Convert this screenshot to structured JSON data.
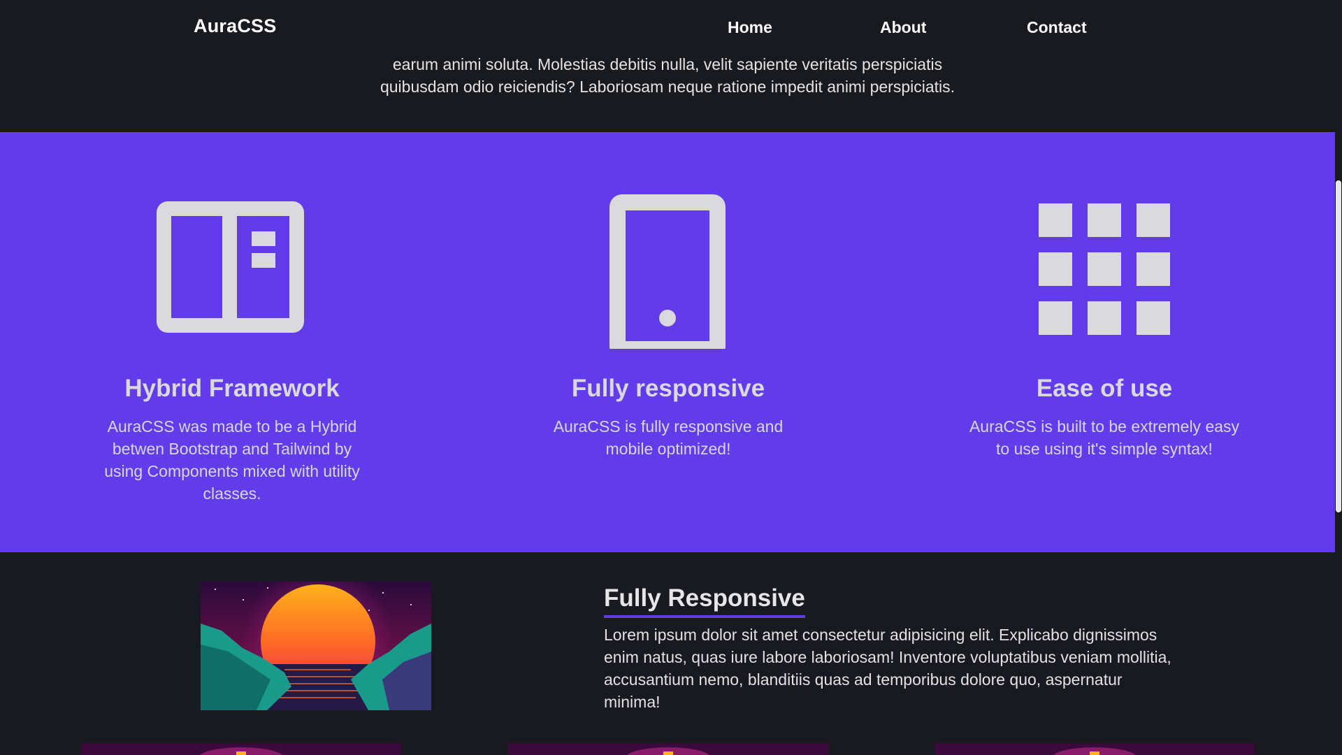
{
  "navbar": {
    "brand": "AuraCSS",
    "links": [
      {
        "label": "Home"
      },
      {
        "label": "About"
      },
      {
        "label": "Contact"
      }
    ]
  },
  "hero": {
    "text_line1": "earum animi soluta. Molestias debitis nulla, velit sapiente veritatis perspiciatis",
    "text_line2": "quibusdam odio reiciendis? Laboriosam neque ratione impedit animi perspiciatis."
  },
  "features": {
    "background_color": "#623ceb",
    "items": [
      {
        "icon": "sidebar-layout-icon",
        "title": "Hybrid Framework",
        "description": "AuraCSS was made to be a Hybrid betwen Bootstrap and Tailwind by using Components mixed with utility classes."
      },
      {
        "icon": "phone-icon",
        "title": "Fully responsive",
        "description": "AuraCSS is fully responsive and mobile optimized!"
      },
      {
        "icon": "grid-icon",
        "title": "Ease of use",
        "description": "AuraCSS is built to be extremely easy to use using it's simple syntax!"
      }
    ]
  },
  "responsive_section": {
    "image": "synthwave-sunset-image",
    "heading": "Fully Responsive",
    "body": "Lorem ipsum dolor sit amet consectetur adipisicing elit. Explicabo dignissimos enim natus, quas iure labore laboriosam! Inventore voluptatibus veniam mollitia, accusantium nemo, blanditiis quas ad temporibus dolore quo, aspernatur minima!"
  },
  "colors": {
    "page_background": "#181a20",
    "accent": "#623ceb",
    "icon_fill": "#d9d9de",
    "text": "#e4e4e6"
  }
}
